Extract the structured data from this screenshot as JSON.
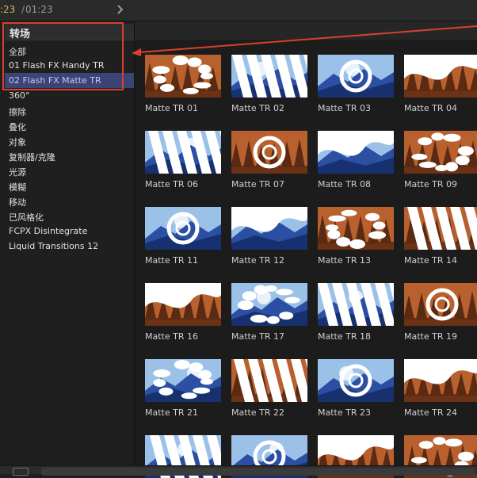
{
  "timecode": {
    "current": ":23",
    "separator": "/",
    "total": "01:23"
  },
  "sidebar": {
    "title": "转场",
    "items": [
      {
        "label": "全部",
        "selected": false
      },
      {
        "label": "01 Flash FX Handy TR",
        "selected": false
      },
      {
        "label": "02 Flash FX Matte TR",
        "selected": true
      },
      {
        "label": "360°",
        "selected": false
      },
      {
        "label": "擦除",
        "selected": false
      },
      {
        "label": "叠化",
        "selected": false
      },
      {
        "label": "对象",
        "selected": false
      },
      {
        "label": "复制器/克隆",
        "selected": false
      },
      {
        "label": "光源",
        "selected": false
      },
      {
        "label": "模糊",
        "selected": false
      },
      {
        "label": "移动",
        "selected": false
      },
      {
        "label": "已风格化",
        "selected": false
      },
      {
        "label": "FCPX Disintegrate",
        "selected": false
      },
      {
        "label": "Liquid Transitions 12",
        "selected": false
      }
    ]
  },
  "browser": {
    "items": [
      {
        "label": "Matte TR 01"
      },
      {
        "label": "Matte TR 02"
      },
      {
        "label": "Matte TR 03"
      },
      {
        "label": "Matte TR 04"
      },
      {
        "label": "Matte TR 06"
      },
      {
        "label": "Matte TR 07"
      },
      {
        "label": "Matte TR 08"
      },
      {
        "label": "Matte TR 09"
      },
      {
        "label": "Matte TR 11"
      },
      {
        "label": "Matte TR 12"
      },
      {
        "label": "Matte TR 13"
      },
      {
        "label": "Matte TR 14"
      },
      {
        "label": "Matte TR 16"
      },
      {
        "label": "Matte TR 17"
      },
      {
        "label": "Matte TR 18"
      },
      {
        "label": "Matte TR 19"
      },
      {
        "label": "Matte TR 21"
      },
      {
        "label": "Matte TR 22"
      },
      {
        "label": "Matte TR 23"
      },
      {
        "label": "Matte TR 24"
      },
      {
        "label": ""
      },
      {
        "label": ""
      },
      {
        "label": ""
      },
      {
        "label": ""
      }
    ]
  },
  "colors": {
    "selection": "#3c4377",
    "annotation": "#d9402f",
    "timecode_accent": "#d6b15a",
    "mountain_blue": "#2b4fa3",
    "forest_orange": "#b8612f"
  }
}
